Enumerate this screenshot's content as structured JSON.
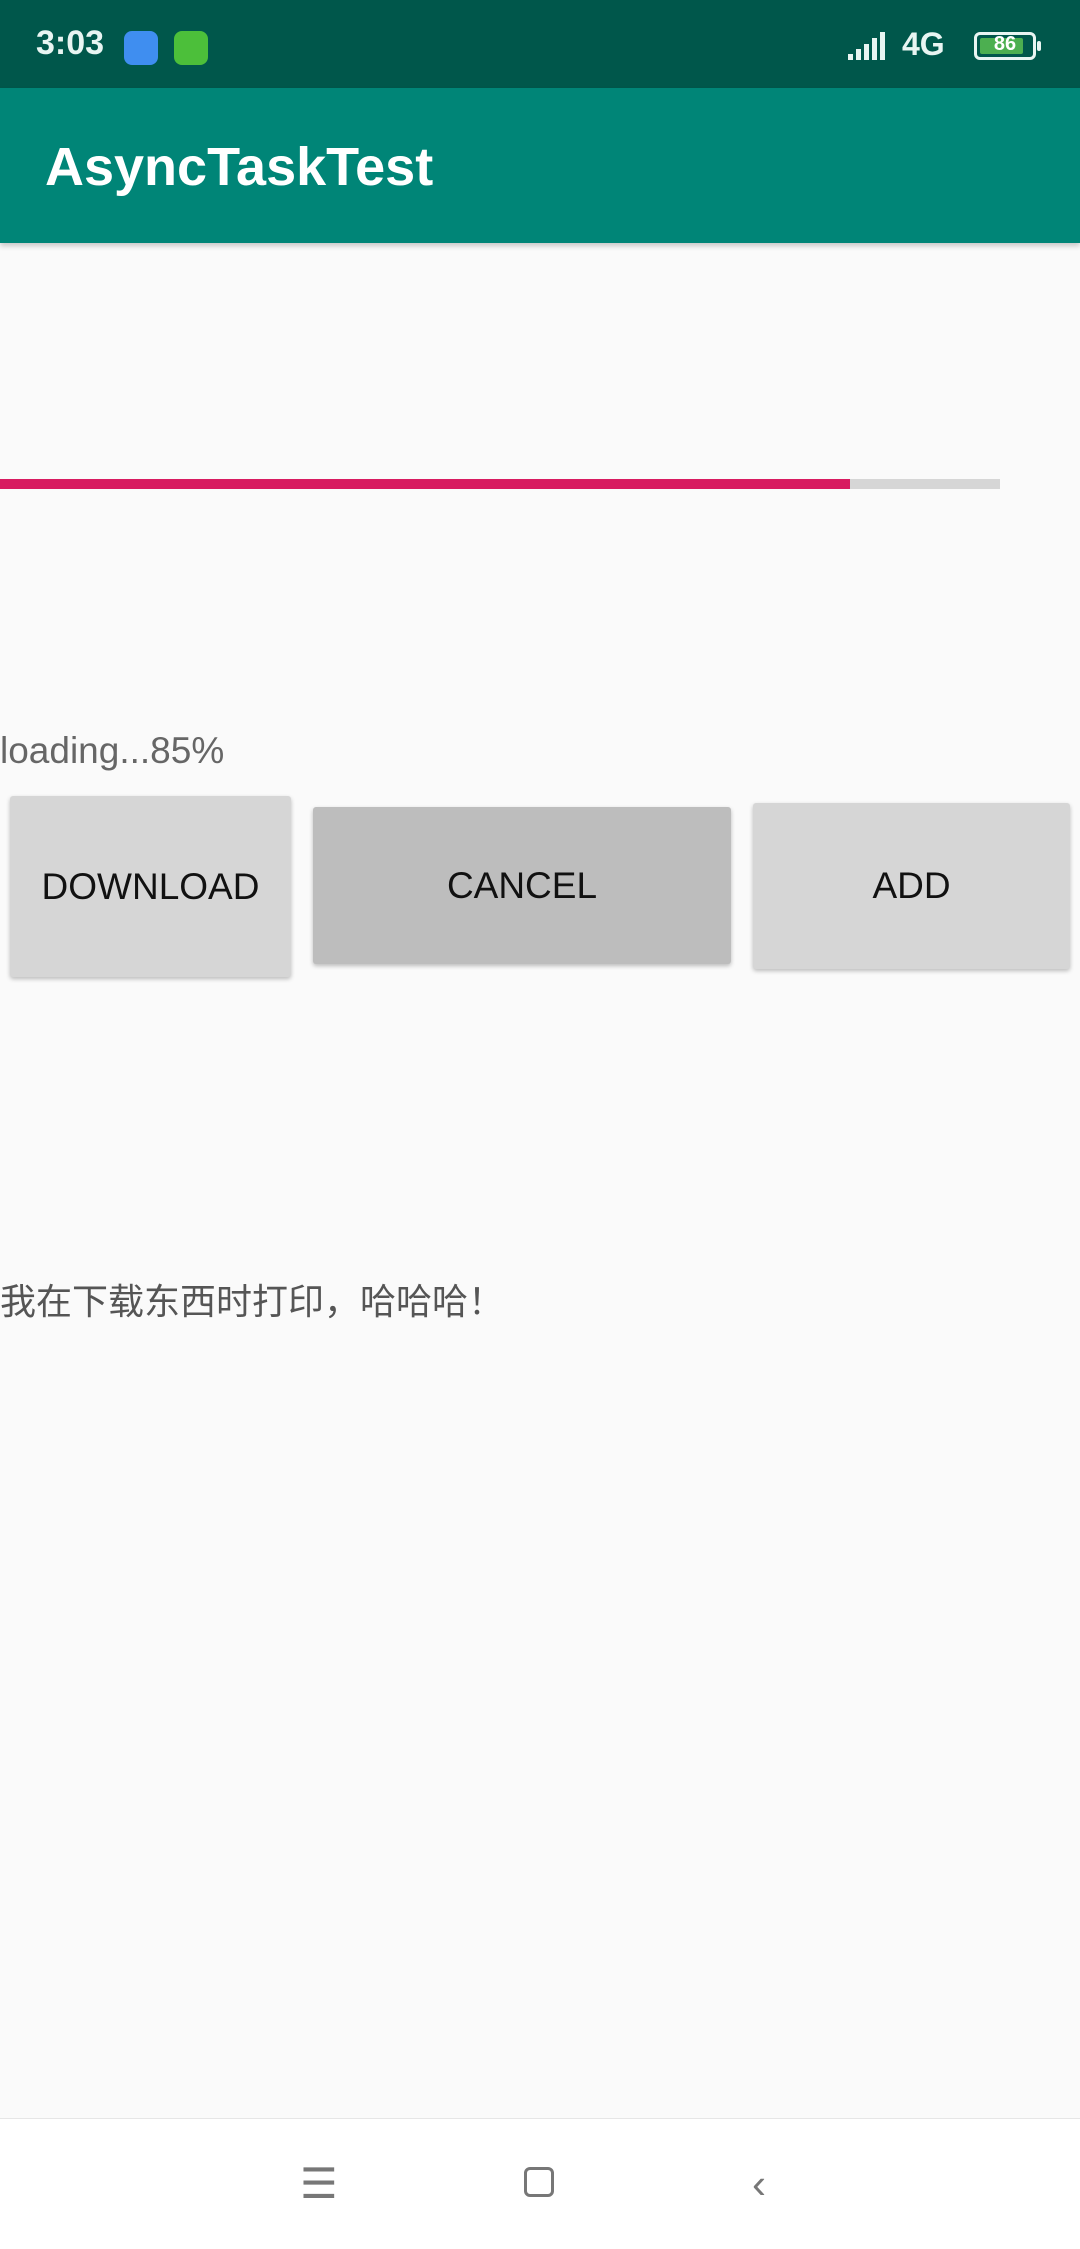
{
  "status_bar": {
    "time": "3:03",
    "network": "4G",
    "battery": "86",
    "battery_level": 86
  },
  "app_bar": {
    "title": "AsyncTaskTest"
  },
  "progress": {
    "value_percent": 85,
    "accent_color": "#d81b60"
  },
  "loading_text": "loading...85%",
  "buttons": {
    "download": "DOWNLOAD",
    "cancel": "CANCEL",
    "add": "ADD"
  },
  "message": "我在下载东西时打印，哈哈哈！",
  "colors": {
    "status_bar": "#00574b",
    "app_bar": "#008577"
  }
}
